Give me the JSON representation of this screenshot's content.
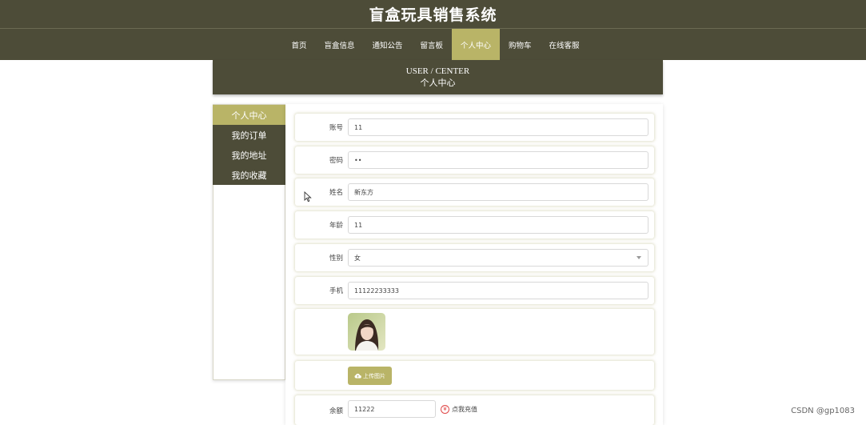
{
  "header": {
    "title": "盲盒玩具销售系统"
  },
  "nav": {
    "items": [
      {
        "label": "首页"
      },
      {
        "label": "盲盒信息"
      },
      {
        "label": "通知公告"
      },
      {
        "label": "留言板"
      },
      {
        "label": "个人中心"
      },
      {
        "label": "购物车"
      },
      {
        "label": "在线客服"
      }
    ],
    "active_index": 4
  },
  "banner": {
    "en": "USER / CENTER",
    "cn": "个人中心"
  },
  "sidebar": {
    "items": [
      {
        "label": "个人中心"
      },
      {
        "label": "我的订单"
      },
      {
        "label": "我的地址"
      },
      {
        "label": "我的收藏"
      }
    ],
    "active_index": 0
  },
  "form": {
    "account": {
      "label": "账号",
      "value": "11"
    },
    "password": {
      "label": "密码",
      "value": "••"
    },
    "name": {
      "label": "姓名",
      "value": "新东方"
    },
    "age": {
      "label": "年龄",
      "value": "11"
    },
    "gender": {
      "label": "性别",
      "value": "女"
    },
    "phone": {
      "label": "手机",
      "value": "11122233333"
    },
    "upload": {
      "label": "上传图片"
    },
    "balance": {
      "label": "余额",
      "value": "11222",
      "recharge_label": "点我充值",
      "recharge_icon_text": "¥"
    }
  },
  "watermark": "CSDN @gp1083",
  "colors": {
    "dark": "#4d4c38",
    "accent": "#b9b467"
  },
  "icons": {
    "cursor": "cursor-arrow-icon",
    "upload": "cloud-upload-icon",
    "recharge": "yen-circle-icon",
    "select": "chevron-down-icon"
  }
}
